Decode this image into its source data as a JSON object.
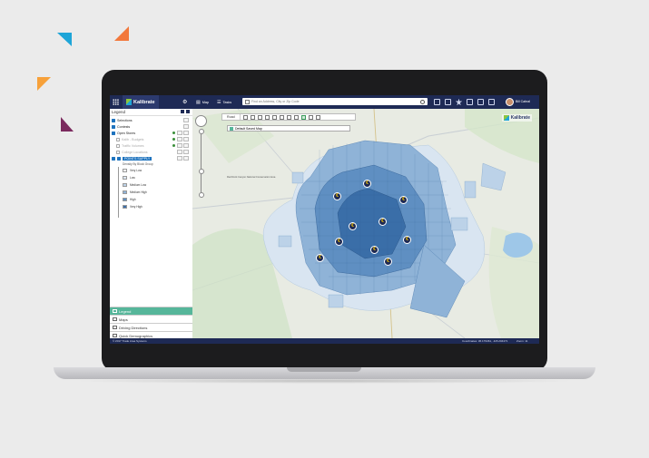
{
  "app": {
    "brand": "Kalibrate",
    "menu": {
      "map_label": "Map",
      "tasks_label": "Tasks"
    },
    "search": {
      "placeholder": "Find an Address, City or Zip Code"
    },
    "user": {
      "name": "Bill Cabral"
    }
  },
  "legend": {
    "title": "Legend",
    "layers": [
      {
        "label": "Selections",
        "checked": true
      },
      {
        "label": "Contests",
        "checked": true
      },
      {
        "label": "Open Stores",
        "checked": true
      },
      {
        "label": "Kalib - Budgets",
        "checked": false
      },
      {
        "label": "Traffic Volumes",
        "checked": false
      },
      {
        "label": "College Locations",
        "checked": false
      },
      {
        "label": "POINTS SUPPLY",
        "checked": true
      }
    ],
    "sub_title": "Density By Block Group",
    "density": [
      {
        "label": "Very Low",
        "color": "#ffffff"
      },
      {
        "label": "Low",
        "color": "#dde8f3"
      },
      {
        "label": "Medium Low",
        "color": "#bcd2e8"
      },
      {
        "label": "Medium High",
        "color": "#8fb3d7"
      },
      {
        "label": "High",
        "color": "#5f8fc2"
      },
      {
        "label": "Very High",
        "color": "#3a6ea8"
      }
    ]
  },
  "accordion": [
    {
      "label": "Legend",
      "active": true
    },
    {
      "label": "Maps",
      "active": false
    },
    {
      "label": "Driving Directions",
      "active": false
    },
    {
      "label": "Quick Demographics",
      "active": false
    }
  ],
  "map": {
    "basemap_label": "Road",
    "layer_name": "Default Saved Map",
    "store_glyph": "€",
    "place_label": "Red Rock Canyon National Conservation Area"
  },
  "footer": {
    "copyright": "© 2017 Trade Area Systems",
    "coordinates": "Coordinates: 36.179461, -115.204471",
    "zoom": "Zoom: 11"
  },
  "colors": {
    "navy": "#1e2a55",
    "accent": "#56b69a",
    "tri_blue": "#1ea5d8",
    "tri_orange": "#f2783c",
    "tri_amber": "#f7a13a",
    "tri_plum": "#7b2a5e"
  }
}
